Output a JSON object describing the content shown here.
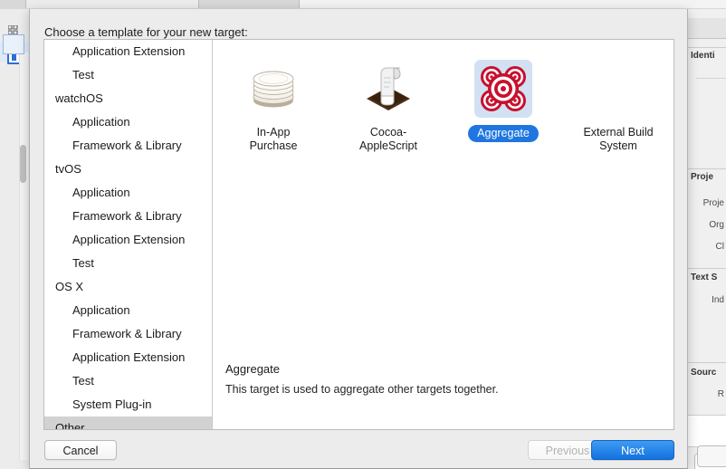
{
  "dialog": {
    "title": "Choose a template for your new target:",
    "categories": [
      {
        "label": "Application Extension",
        "level": "child",
        "selected": false
      },
      {
        "label": "Test",
        "level": "child",
        "selected": false
      },
      {
        "label": "watchOS",
        "level": "group",
        "selected": false
      },
      {
        "label": "Application",
        "level": "child",
        "selected": false
      },
      {
        "label": "Framework & Library",
        "level": "child",
        "selected": false
      },
      {
        "label": "tvOS",
        "level": "group",
        "selected": false
      },
      {
        "label": "Application",
        "level": "child",
        "selected": false
      },
      {
        "label": "Framework & Library",
        "level": "child",
        "selected": false
      },
      {
        "label": "Application Extension",
        "level": "child",
        "selected": false
      },
      {
        "label": "Test",
        "level": "child",
        "selected": false
      },
      {
        "label": "OS X",
        "level": "group",
        "selected": false
      },
      {
        "label": "Application",
        "level": "child",
        "selected": false
      },
      {
        "label": "Framework & Library",
        "level": "child",
        "selected": false
      },
      {
        "label": "Application Extension",
        "level": "child",
        "selected": false
      },
      {
        "label": "Test",
        "level": "child",
        "selected": false
      },
      {
        "label": "System Plug-in",
        "level": "child",
        "selected": false
      },
      {
        "label": "Other",
        "level": "group",
        "selected": true
      }
    ],
    "templates": [
      {
        "label": "In-App\nPurchase",
        "icon": "coin-stack-icon",
        "selected": false
      },
      {
        "label": "Cocoa-\nAppleScript",
        "icon": "applescript-scroll-icon",
        "selected": false
      },
      {
        "label": "Aggregate",
        "icon": "aggregate-target-icon",
        "selected": true
      },
      {
        "label": "External Build\nSystem",
        "icon": "external-build-icon",
        "selected": false
      }
    ],
    "description": {
      "title": "Aggregate",
      "body": "This target is used to aggregate other targets together."
    },
    "buttons": {
      "cancel": "Cancel",
      "previous": "Previous",
      "next": "Next"
    },
    "colors": {
      "accent": "#1f76e0",
      "selection_tint": "#d2e0f4",
      "list_selection": "#d2d2d2",
      "target_red": "#c8102e"
    }
  },
  "inspector": {
    "sections": [
      {
        "label": "Identi",
        "type": "header"
      },
      {
        "label": "Proje",
        "type": "header"
      },
      {
        "label": "Proje",
        "type": "label"
      },
      {
        "label": "Org",
        "type": "label"
      },
      {
        "label": "Cl",
        "type": "label"
      },
      {
        "label": "Text S",
        "type": "header"
      },
      {
        "label": "Ind",
        "type": "label"
      },
      {
        "label": "Sourc",
        "type": "header"
      },
      {
        "label": "R",
        "type": "label"
      }
    ]
  }
}
